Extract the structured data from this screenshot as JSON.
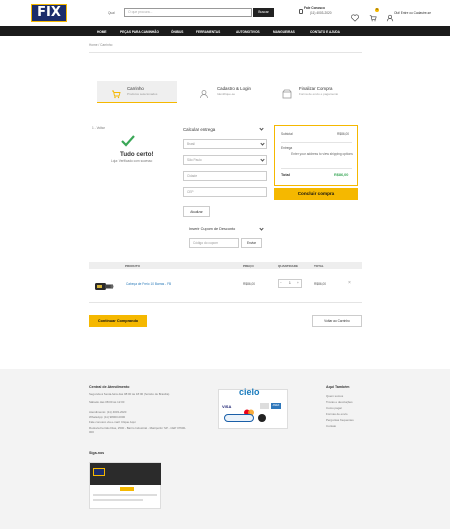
{
  "header": {
    "logo_text": "FIX",
    "search_label": "Qual",
    "search_placeholder": "O que procura...",
    "search_button": "Buscar",
    "phone_title": "Fale Conosco",
    "phone_number": "(11) 4003-2020",
    "cart_count": "1",
    "login_text": "Olá! Entre ou Cadastre-se"
  },
  "nav": {
    "items": [
      "HOME",
      "PEÇAS PARA CAMINHÃO",
      "ÔNIBUS",
      "FERRAMENTAS",
      "AUTOMOTIVOS",
      "MANGUEIRAS",
      "CONTATO E AJUDA"
    ]
  },
  "breadcrumb": "Home / Carrinho",
  "steps": [
    {
      "title": "Carrinho",
      "sub": "Produtos selecionados"
    },
    {
      "title": "Cadastro & Login",
      "sub": "Identifique-se"
    },
    {
      "title": "Finalizar Compra",
      "sub": "Forma de envio e pagamento"
    }
  ],
  "confirmation": {
    "back_label": "1 - Voltar",
    "title": "Tudo certo!",
    "message": "Loja: Verificado com sucesso"
  },
  "shipping": {
    "title": "Calcular entrega",
    "country": "Brasil",
    "state": "São Paulo",
    "city_placeholder": "Cidade",
    "cep_placeholder": "CEP",
    "calc_button": "Atualizar",
    "coupon_title": "Inserir Cupom de Desconto",
    "coupon_placeholder": "Código do cupom",
    "coupon_button": "Enviar"
  },
  "summary": {
    "subtotal_label": "Subtotal",
    "subtotal_value": "R$86,00",
    "shipping_label": "Entrega",
    "shipping_text": "Enter your address to view shipping options",
    "total_label": "Total",
    "total_value": "R$86,00",
    "checkout_button": "Concluir compra"
  },
  "table": {
    "headers": [
      "PRODUTO",
      "PREÇO",
      "QUANTIDADE",
      "TOTAL"
    ],
    "row": {
      "name": "Cabeça de Freio 10 Barras - FB",
      "price": "R$86,00",
      "qty": "1",
      "total": "R$86,00"
    }
  },
  "continue_button": "Continuar Comprando",
  "back_button": "Voltar ao Carrinho",
  "footer": {
    "contact_title": "Central de Atendimento",
    "contact_lines": [
      "Segunda à Sexta-feira das 08:00 às 18:00 (horário de Brasília)",
      "Sábado das 08:00 às 12:00"
    ],
    "phone_line": "Atendimento: (11) 4003-2020",
    "whats_line": "WhatsApp: (11) 98000-0000",
    "email_line": "Fale conosco via e-mail: Clique Aqui",
    "address_line": "Rodovia Fernão Dias, 2500 - Bairro Industrial - Mairiporã / SP - CEP 07600-000",
    "follow_title": "Siga-nos",
    "cielo_text": "cielo",
    "card_labels": [
      "VISA",
      "MC",
      "AMEX"
    ],
    "links_title": "Aqui Também",
    "links": [
      "Quem somos",
      "Trocas e devoluções",
      "Como pagar",
      "Formas de envio",
      "Perguntas frequentes",
      "Contato"
    ]
  },
  "colors": {
    "accent": "#f5b800",
    "nav": "#1b1b1b",
    "link_blue": "#2a7ab9",
    "success": "#3aa757"
  }
}
